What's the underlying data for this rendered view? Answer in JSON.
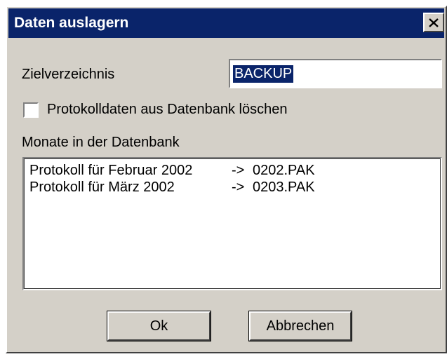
{
  "window": {
    "title": "Daten auslagern",
    "close_icon": "close-x-icon"
  },
  "target_dir": {
    "label": "Zielverzeichnis",
    "value": "BACKUP"
  },
  "delete_option": {
    "label": "Protokolldaten aus Datenbank löschen",
    "checked": false
  },
  "months": {
    "label": "Monate in der Datenbank",
    "items": [
      {
        "description": "Protokoll für Februar 2002",
        "arrow": "->",
        "file": "0202.PAK"
      },
      {
        "description": "Protokoll für März 2002",
        "arrow": "->",
        "file": "0203.PAK"
      }
    ]
  },
  "buttons": {
    "ok": "Ok",
    "cancel": "Abbrechen"
  },
  "colors": {
    "titlebar": "#0a246a",
    "face": "#d4d0c8",
    "selection": "#0a246a"
  }
}
